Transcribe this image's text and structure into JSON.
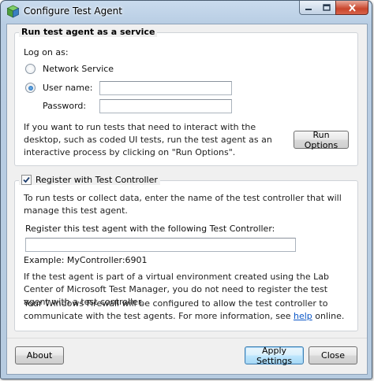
{
  "window": {
    "title": "Configure Test Agent"
  },
  "service_group": {
    "title": "Run test agent as a service",
    "log_on_as_label": "Log on as:",
    "network_service_label": "Network Service",
    "network_service_selected": false,
    "user_name_label": "User name:",
    "user_name_selected": true,
    "user_name_value": "",
    "password_label": "Password:",
    "password_value": "",
    "interactive_text": "If you want to run tests that need to interact with the desktop, such as coded UI tests, run the test agent as an interactive process by clicking on \"Run Options\".",
    "run_options_button": "Run Options"
  },
  "controller_group": {
    "register_label": "Register with Test Controller",
    "register_checked": true,
    "intro_text": "To run tests or collect data, enter the name of the test controller that will manage this test agent.",
    "controller_field_label": "Register this test agent with the following Test Controller:",
    "controller_value": "",
    "example_text": "Example: MyController:6901",
    "virtual_env_text": "If the test agent is part of a virtual environment created using the Lab Center of Microsoft Test Manager, you do not need to register the test agent with a test controller.",
    "firewall_text_before": "Your Windows Firewall will be configured to allow the test controller to communicate with the test agents. For more information, see ",
    "firewall_link": "help",
    "firewall_text_after": " online."
  },
  "footer": {
    "about_button": "About",
    "apply_button": "Apply Settings",
    "close_button": "Close"
  },
  "icons": {
    "app": "test-agent-icon",
    "minimize": "minimize-icon",
    "maximize": "maximize-icon",
    "close": "close-icon"
  }
}
